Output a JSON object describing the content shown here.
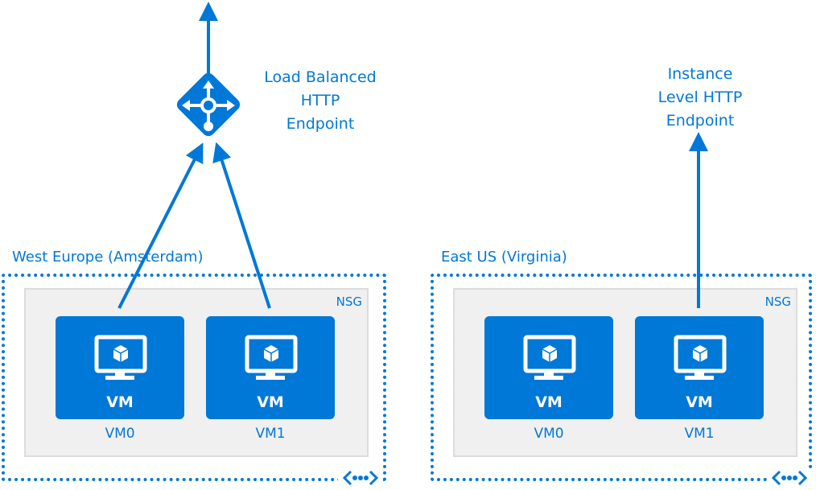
{
  "colors": {
    "accent": "#0078d7",
    "nsg_bg": "#f0f0f0",
    "white": "#ffffff"
  },
  "load_balancer": {
    "icon": "load-balancer-icon",
    "label_lines": [
      "Load Balanced",
      "HTTP",
      "Endpoint"
    ]
  },
  "instance_endpoint": {
    "label_lines": [
      "Instance",
      "Level HTTP",
      "Endpoint"
    ]
  },
  "regions": [
    {
      "title": "West Europe (Amsterdam)",
      "nsg_label": "NSG",
      "vnet_icon": "virtual-network-icon",
      "vms": [
        {
          "type_label": "VM",
          "name": "VM0",
          "icon": "virtual-machine-icon"
        },
        {
          "type_label": "VM",
          "name": "VM1",
          "icon": "virtual-machine-icon"
        }
      ]
    },
    {
      "title": "East US (Virginia)",
      "nsg_label": "NSG",
      "vnet_icon": "virtual-network-icon",
      "vms": [
        {
          "type_label": "VM",
          "name": "VM0",
          "icon": "virtual-machine-icon"
        },
        {
          "type_label": "VM",
          "name": "VM1",
          "icon": "virtual-machine-icon"
        }
      ]
    }
  ]
}
